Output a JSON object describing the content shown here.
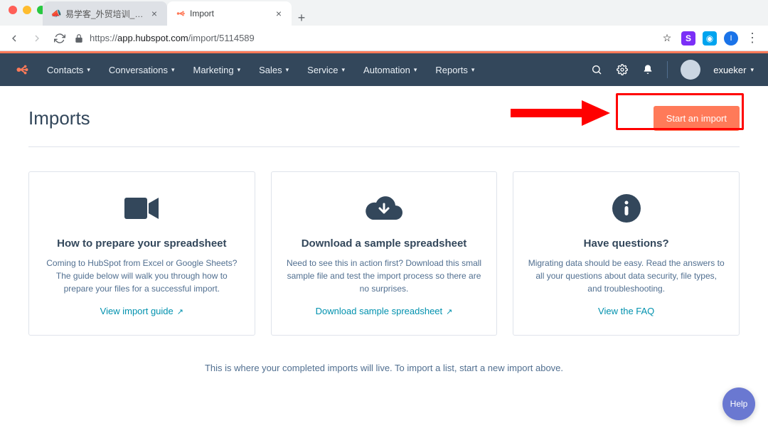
{
  "browser": {
    "tabs": [
      {
        "label": "易学客_外贸培训_外贸业务培训",
        "active": false
      },
      {
        "label": "Import",
        "active": true
      }
    ],
    "url_host": "app.hubspot.com",
    "url_path": "/import/5114589",
    "url_prefix": "https://"
  },
  "nav": {
    "items": [
      "Contacts",
      "Conversations",
      "Marketing",
      "Sales",
      "Service",
      "Automation",
      "Reports"
    ],
    "user": "exueker"
  },
  "page": {
    "title": "Imports",
    "cta": "Start an import",
    "cards": [
      {
        "title": "How to prepare your spreadsheet",
        "desc": "Coming to HubSpot from Excel or Google Sheets? The guide below will walk you through how to prepare your files for a successful import.",
        "link": "View import guide"
      },
      {
        "title": "Download a sample spreadsheet",
        "desc": "Need to see this in action first? Download this small sample file and test the import process so there are no surprises.",
        "link": "Download sample spreadsheet"
      },
      {
        "title": "Have questions?",
        "desc": "Migrating data should be easy. Read the answers to all your questions about data security, file types, and troubleshooting.",
        "link": "View the FAQ"
      }
    ],
    "empty": "This is where your completed imports will live. To import a list, start a new import above."
  },
  "help": "Help"
}
